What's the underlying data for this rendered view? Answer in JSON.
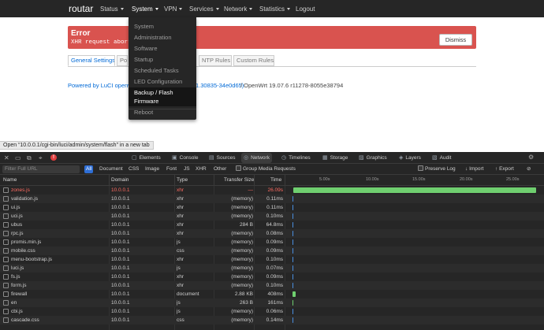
{
  "router": {
    "brand": "routar",
    "nav": [
      "Status",
      "System",
      "VPN",
      "Services",
      "Network",
      "Statistics",
      "Logout"
    ],
    "system_menu": [
      "System",
      "Administration",
      "Software",
      "Startup",
      "Scheduled Tasks",
      "LED Configuration",
      "Backup / Flash",
      "Firmware",
      "Reboot"
    ],
    "error": {
      "title": "Error",
      "message": "XHR request aborted",
      "dismiss": "Dismiss"
    },
    "tabs": [
      "General Settings",
      "Po",
      "NTP Rules",
      "Custom Rules"
    ],
    "footer": {
      "powered": "Powered by LuCI openwrt",
      "build": "1.30835-34e0d65)",
      "version": " / OpenWrt 19.07.6 r11278-8055e38794"
    }
  },
  "status_bar": "Open “10.0.0.1/cgi-bin/luci/admin/system/flash” in a new tab",
  "devtools": {
    "tabs": [
      "Elements",
      "Console",
      "Sources",
      "Network",
      "Timelines",
      "Storage",
      "Graphics",
      "Layers",
      "Audit"
    ],
    "active_tab": "Network",
    "error_count": "!",
    "filter_placeholder": "Filter Full URL",
    "type_filters": [
      "All",
      "Document",
      "CSS",
      "Image",
      "Font",
      "JS",
      "XHR",
      "Other"
    ],
    "group_media": "Group Media Requests",
    "preserve_log": "Preserve Log",
    "import": "Import",
    "export": "Export",
    "columns": [
      "Name",
      "Domain",
      "Type",
      "Transfer Size",
      "Time"
    ],
    "ticks": [
      "5.00s",
      "10.00s",
      "15.00s",
      "20.00s",
      "25.00s"
    ],
    "requests": [
      {
        "name": "zones.js",
        "domain": "10.0.0.1",
        "type": "xhr",
        "size": "—",
        "time": "26.09s",
        "error": true
      },
      {
        "name": "validation.js",
        "domain": "10.0.0.1",
        "type": "xhr",
        "size": "(memory)",
        "time": "0.11ms"
      },
      {
        "name": "ui.js",
        "domain": "10.0.0.1",
        "type": "xhr",
        "size": "(memory)",
        "time": "0.11ms"
      },
      {
        "name": "uci.js",
        "domain": "10.0.0.1",
        "type": "xhr",
        "size": "(memory)",
        "time": "0.10ms"
      },
      {
        "name": "ubus",
        "domain": "10.0.0.1",
        "type": "xhr",
        "size": "284 B",
        "time": "64.8ms"
      },
      {
        "name": "rpc.js",
        "domain": "10.0.0.1",
        "type": "xhr",
        "size": "(memory)",
        "time": "0.08ms"
      },
      {
        "name": "promis.min.js",
        "domain": "10.0.0.1",
        "type": "js",
        "size": "(memory)",
        "time": "0.09ms"
      },
      {
        "name": "mobile.css",
        "domain": "10.0.0.1",
        "type": "css",
        "size": "(memory)",
        "time": "0.09ms"
      },
      {
        "name": "menu-bootstrap.js",
        "domain": "10.0.0.1",
        "type": "xhr",
        "size": "(memory)",
        "time": "0.10ms"
      },
      {
        "name": "luci.js",
        "domain": "10.0.0.1",
        "type": "js",
        "size": "(memory)",
        "time": "0.07ms"
      },
      {
        "name": "fs.js",
        "domain": "10.0.0.1",
        "type": "xhr",
        "size": "(memory)",
        "time": "0.09ms"
      },
      {
        "name": "form.js",
        "domain": "10.0.0.1",
        "type": "xhr",
        "size": "(memory)",
        "time": "0.10ms"
      },
      {
        "name": "firewall",
        "domain": "10.0.0.1",
        "type": "document",
        "size": "2.88 KB",
        "time": "408ms"
      },
      {
        "name": "en",
        "domain": "10.0.0.1",
        "type": "js",
        "size": "263 B",
        "time": "161ms"
      },
      {
        "name": "cbi.js",
        "domain": "10.0.0.1",
        "type": "js",
        "size": "(memory)",
        "time": "0.06ms"
      },
      {
        "name": "cascade.css",
        "domain": "10.0.0.1",
        "type": "css",
        "size": "(memory)",
        "time": "0.14ms"
      }
    ]
  },
  "colors": {
    "nav_bg": "#262626",
    "error_bg": "#d9534f",
    "link": "#0069d6",
    "devtools_bg": "#262626",
    "waterfall_green": "#6fcf6f",
    "waterfall_blue": "#4a8fe0",
    "error_text": "#ff6b61"
  }
}
